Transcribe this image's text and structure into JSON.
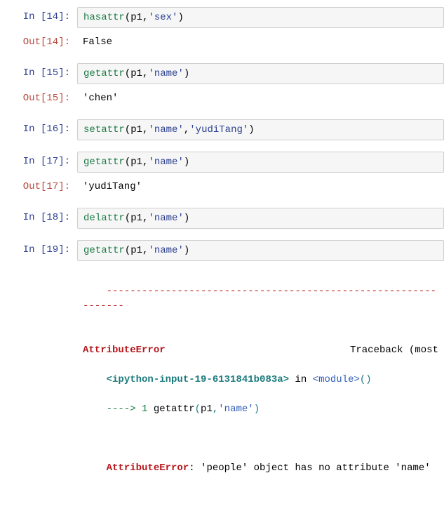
{
  "cells": {
    "c14": {
      "in_label": "In  [14]:",
      "out_label": "Out[14]:",
      "code_func": "hasattr",
      "code_open": "(",
      "code_arg1": "p1",
      "code_comma": ",",
      "code_str": "'sex'",
      "code_close": ")",
      "output": "False"
    },
    "c15": {
      "in_label": "In  [15]:",
      "out_label": "Out[15]:",
      "code_func": "getattr",
      "code_open": "(",
      "code_arg1": "p1",
      "code_comma": ",",
      "code_str": "'name'",
      "code_close": ")",
      "output": "'chen'"
    },
    "c16": {
      "in_label": "In  [16]:",
      "code_func": "setattr",
      "code_open": "(",
      "code_arg1": "p1",
      "code_comma1": ",",
      "code_str1": "'name'",
      "code_comma2": ",",
      "code_str2": "'yudiTang'",
      "code_close": ")"
    },
    "c17": {
      "in_label": "In  [17]:",
      "out_label": "Out[17]:",
      "code_func": "getattr",
      "code_open": "(",
      "code_arg1": "p1",
      "code_comma": ",",
      "code_str": "'name'",
      "code_close": ")",
      "output": "'yudiTang'"
    },
    "c18": {
      "in_label": "In  [18]:",
      "code_func": "delattr",
      "code_open": "(",
      "code_arg1": "p1",
      "code_comma": ",",
      "code_str": "'name'",
      "code_close": ")"
    },
    "c19": {
      "in_label": "In  [19]:",
      "code_func": "getattr",
      "code_open": "(",
      "code_arg1": "p1",
      "code_comma": ",",
      "code_str": "'name'",
      "code_close": ")"
    }
  },
  "error": {
    "hr": "---------------------------------------------------------------",
    "err_name": "AttributeError",
    "tb_right": "Traceback (most",
    "loc_name": "<ipython-input-19-6131841b083a>",
    "loc_in": " in ",
    "loc_mod": "<module>",
    "loc_parens": "()",
    "arrow": "----> 1 ",
    "arrow_func": "getattr",
    "arrow_open": "(",
    "arrow_arg": "p1",
    "arrow_comma": ",",
    "arrow_str": "'name'",
    "arrow_close": ")",
    "final_name": "AttributeError",
    "final_msg": ": 'people' object has no attribute 'name'"
  }
}
